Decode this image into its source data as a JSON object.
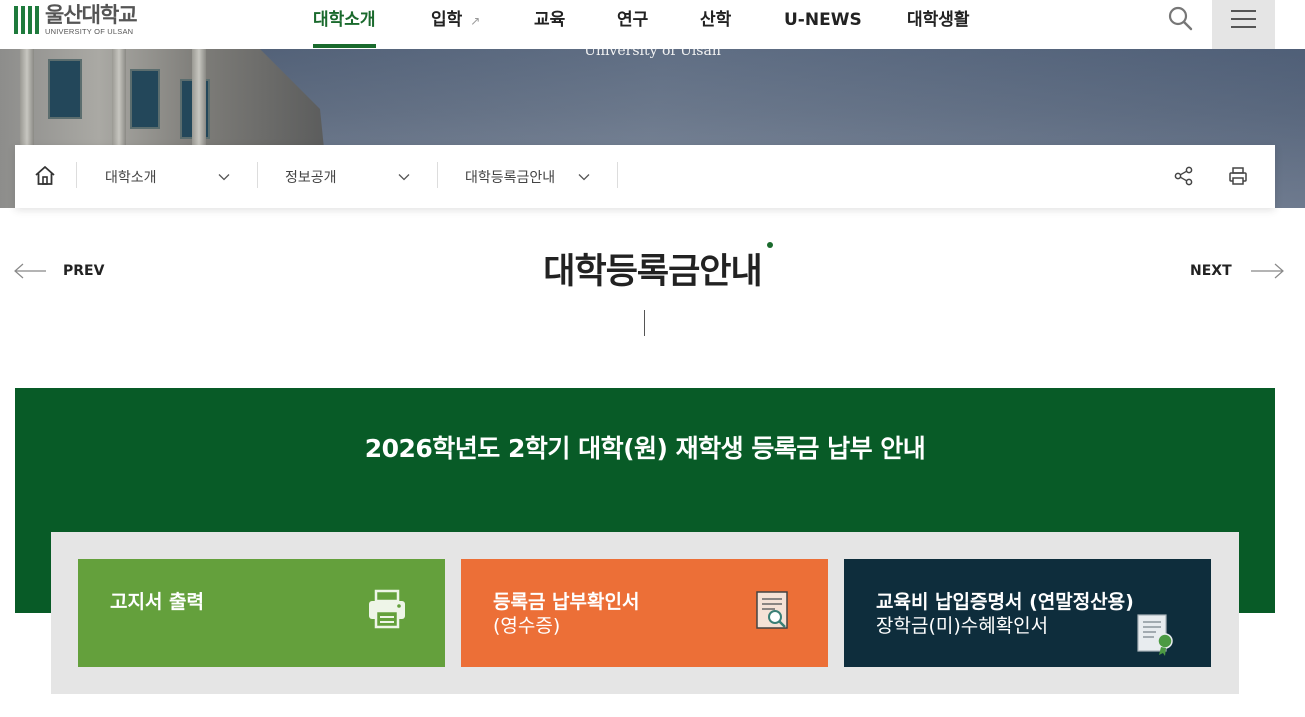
{
  "logo": {
    "main": "울산대학교",
    "sub": "UNIVERSITY OF ULSAN",
    "brand_color": "#1e7a3c"
  },
  "nav": {
    "items": [
      {
        "label": "대학소개",
        "active": true
      },
      {
        "label": "입학",
        "external": true
      },
      {
        "label": "교육"
      },
      {
        "label": "연구"
      },
      {
        "label": "산학"
      },
      {
        "label": "U-NEWS"
      },
      {
        "label": "대학생활"
      }
    ],
    "external_marker": "↗",
    "search_icon": "search-icon",
    "menu_icon": "hamburger-menu-icon",
    "active_color": "#1a6a2d"
  },
  "hero": {
    "caption": "University of Ulsan"
  },
  "breadcrumb": {
    "home_icon": "home-icon",
    "items": [
      {
        "label": "대학소개"
      },
      {
        "label": "정보공개"
      },
      {
        "label": "대학등록금안내"
      }
    ],
    "share_icon": "share-icon",
    "print_icon": "print-icon"
  },
  "page": {
    "title": "대학등록금안내",
    "prev_label": "PREV",
    "next_label": "NEXT"
  },
  "notice": {
    "title": "2026학년도 2학기 대학(원) 재학생 등록금 납부 안내",
    "background": "#085b27"
  },
  "cards": [
    {
      "line1": "고지서 출력",
      "line2": "",
      "icon": "printer-icon",
      "color": "#64a03c"
    },
    {
      "line1": "등록금 납부확인서",
      "line2": "(영수증)",
      "icon": "receipt-icon",
      "color": "#ec6f37"
    },
    {
      "line1": "교육비 납입증명서 (연말정산용)",
      "line2": "장학금(미)수혜확인서",
      "icon": "certificate-icon",
      "color": "#0e2d3c"
    }
  ]
}
